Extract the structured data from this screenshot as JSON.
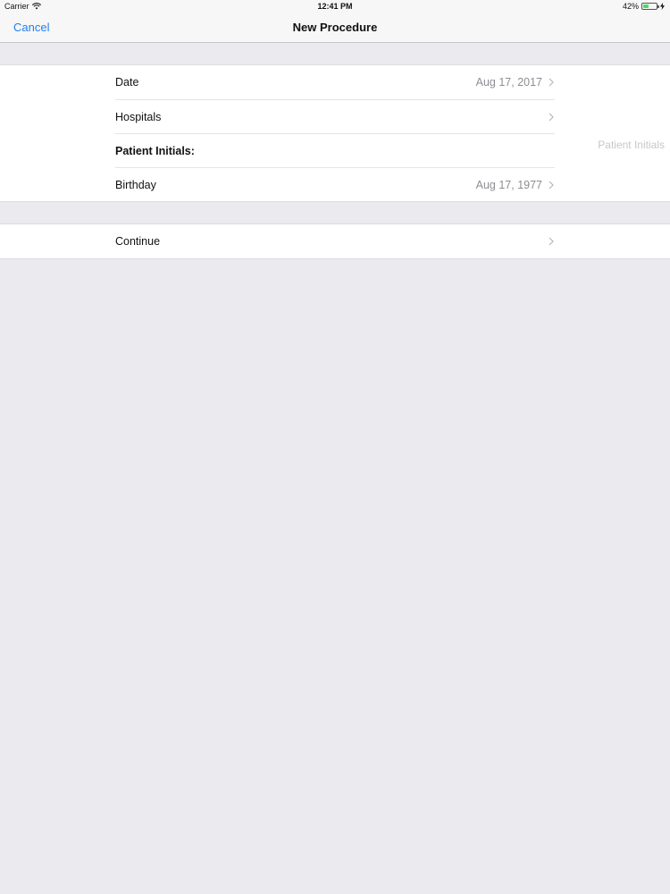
{
  "status_bar": {
    "carrier": "Carrier",
    "time": "12:41 PM",
    "battery": "42%",
    "battery_level": 0.42
  },
  "nav": {
    "cancel_label": "Cancel",
    "title": "New Procedure"
  },
  "form": {
    "date_label": "Date",
    "date_value": "Aug 17, 2017",
    "hospitals_label": "Hospitals",
    "patient_initials_label": "Patient Initials:",
    "patient_initials_placeholder": "Patient Initials",
    "birthday_label": "Birthday",
    "birthday_value": "Aug 17, 1977"
  },
  "actions": {
    "continue_label": "Continue"
  },
  "colors": {
    "accent": "#1f7ff5",
    "background": "#ebeaef",
    "secondary_text": "#8e8e93"
  }
}
